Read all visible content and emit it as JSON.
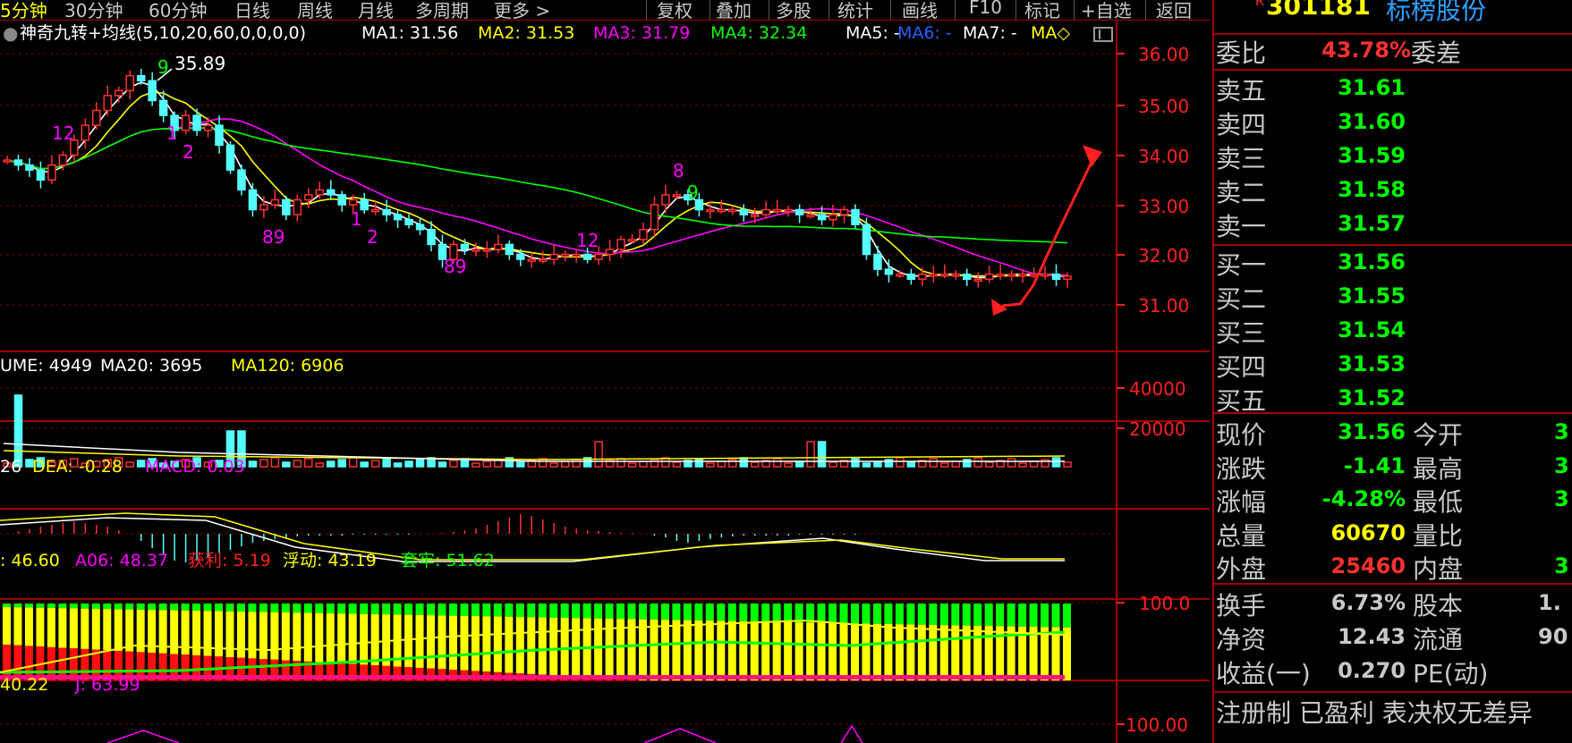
{
  "toolbar": {
    "left_tabs": [
      "5分钟",
      "30分钟",
      "60分钟",
      "日线",
      "周线",
      "月线",
      "多周期",
      "更多 >"
    ],
    "right_tabs": [
      "复权",
      "叠加",
      "多股",
      "统计",
      "画线",
      "F10",
      "标记",
      "+自选",
      "返回"
    ]
  },
  "main": {
    "indicator": "神奇九转+均线(5,10,20,60,0,0,0,0)",
    "ma": [
      {
        "label": "MA1: 31.56",
        "color": "#ffffff"
      },
      {
        "label": "MA2: 31.53",
        "color": "#ffff00"
      },
      {
        "label": "MA3: 31.79",
        "color": "#ff00ff"
      },
      {
        "label": "MA4: 32.34",
        "color": "#00ff00"
      },
      {
        "label": "MA5: -",
        "color": "#ffffff"
      },
      {
        "label": "MA6: -",
        "color": "#2060ff"
      },
      {
        "label": "MA7: -",
        "color": "#ffffff"
      },
      {
        "label": "MA◇",
        "color": "#ffff00"
      }
    ],
    "high_label": "35.89",
    "price_axis": [
      "36.00",
      "35.00",
      "34.00",
      "33.00",
      "32.00",
      "31.00"
    ],
    "nine_labels": [
      "9",
      "12",
      "1",
      "2",
      "89",
      "1",
      "2",
      "89",
      "12",
      "8",
      "9"
    ]
  },
  "volume": {
    "legend": [
      {
        "label": "UME: 4949",
        "color": "#ffffff"
      },
      {
        "label": "MA20: 3695",
        "color": "#ffffff"
      },
      {
        "label": "MA120: 6906",
        "color": "#ffff00"
      }
    ],
    "axis": [
      "40000",
      "20000"
    ]
  },
  "macd": {
    "legend": [
      {
        "label": "26",
        "color": "#ffffff"
      },
      {
        "label": "DEA: -0.28",
        "color": "#ffff00"
      },
      {
        "label": "MACD: 0.03",
        "color": "#ff00ff"
      }
    ]
  },
  "chip": {
    "legend": [
      {
        "label": ": 46.60",
        "color": "#ffff00"
      },
      {
        "label": "A06: 48.37",
        "color": "#ff00ff"
      },
      {
        "label": "获利: 5.19",
        "color": "#ff2020"
      },
      {
        "label": "浮动: 43.19",
        "color": "#ffff00"
      },
      {
        "label": "套牢: 51.62",
        "color": "#00ff00"
      }
    ],
    "axis": [
      "100.0"
    ]
  },
  "kdj": {
    "legend": [
      {
        "label": "40.22",
        "color": "#ffff00"
      },
      {
        "label": "J: 63.99",
        "color": "#ff00ff"
      }
    ],
    "axis": [
      "100.00"
    ]
  },
  "quote": {
    "code": "301181",
    "name": "标榜股份",
    "weibi_label": "委比",
    "weibi_value": "43.78%",
    "weicha_label": "委差",
    "asks": [
      {
        "label": "卖五",
        "price": "31.61"
      },
      {
        "label": "卖四",
        "price": "31.60"
      },
      {
        "label": "卖三",
        "price": "31.59"
      },
      {
        "label": "卖二",
        "price": "31.58"
      },
      {
        "label": "卖一",
        "price": "31.57"
      }
    ],
    "bids": [
      {
        "label": "买一",
        "price": "31.56"
      },
      {
        "label": "买二",
        "price": "31.55"
      },
      {
        "label": "买三",
        "price": "31.54"
      },
      {
        "label": "买四",
        "price": "31.53"
      },
      {
        "label": "买五",
        "price": "31.52"
      }
    ],
    "stats": [
      {
        "label": "现价",
        "value": "31.56",
        "color": "#00ff00",
        "label2": "今开",
        "value2": "3"
      },
      {
        "label": "涨跌",
        "value": "-1.41",
        "color": "#00ff00",
        "label2": "最高",
        "value2": "3"
      },
      {
        "label": "涨幅",
        "value": "-4.28%",
        "color": "#00ff00",
        "label2": "最低",
        "value2": "3"
      },
      {
        "label": "总量",
        "value": "60670",
        "color": "#ffff00",
        "label2": "量比",
        "value2": ""
      },
      {
        "label": "外盘",
        "value": "25460",
        "color": "#ff3030",
        "label2": "内盘",
        "value2": "3"
      }
    ],
    "stats2": [
      {
        "label": "换手",
        "value": "6.73%",
        "label2": "股本",
        "value2": "1."
      },
      {
        "label": "净资",
        "value": "12.43",
        "label2": "流通",
        "value2": "90"
      },
      {
        "label": "收益(一)",
        "value": "0.270",
        "label2": "PE(动)",
        "value2": ""
      }
    ],
    "tags": "注册制 已盈利 表决权无差异"
  }
}
